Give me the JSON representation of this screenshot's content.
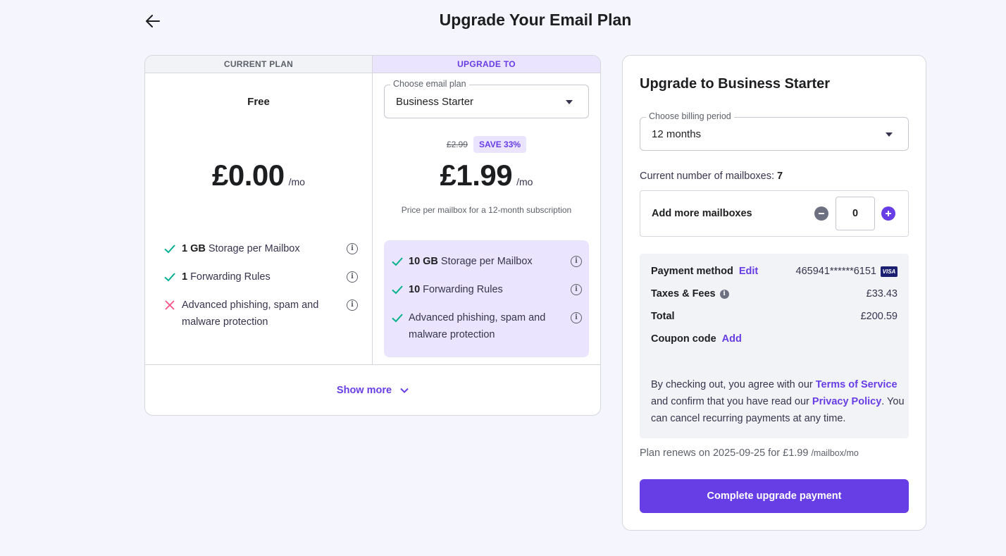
{
  "page": {
    "title": "Upgrade Your Email Plan"
  },
  "current_plan": {
    "header": "CURRENT PLAN",
    "name": "Free",
    "price": "£0.00",
    "per": "/mo",
    "features": [
      {
        "bold": "1 GB",
        "text": "Storage per Mailbox",
        "included": true
      },
      {
        "bold": "1",
        "text": "Forwarding Rules",
        "included": true
      },
      {
        "bold": "",
        "text": "Advanced phishing, spam and malware protection",
        "included": false
      }
    ]
  },
  "upgrade_plan": {
    "header": "UPGRADE TO",
    "select_label": "Choose email plan",
    "select_value": "Business Starter",
    "old_price": "£2.99",
    "save_badge": "SAVE 33%",
    "price": "£1.99",
    "per": "/mo",
    "price_note": "Price per mailbox for a 12-month subscription",
    "features": [
      {
        "bold": "10 GB",
        "text": "Storage per Mailbox",
        "included": true
      },
      {
        "bold": "10",
        "text": "Forwarding Rules",
        "included": true
      },
      {
        "bold": "",
        "text": "Advanced phishing, spam and malware protection",
        "included": true
      }
    ]
  },
  "show_more": "Show more",
  "checkout": {
    "title": "Upgrade to Business Starter",
    "billing_label": "Choose billing period",
    "billing_value": "12 months",
    "mailbox_count_label": "Current number of mailboxes:",
    "mailbox_count": "7",
    "add_mailboxes_label": "Add more mailboxes",
    "add_mailboxes_value": "0",
    "payment_method_label": "Payment method",
    "payment_edit": "Edit",
    "card_number": "465941******6151",
    "card_brand": "VISA",
    "taxes_label": "Taxes & Fees",
    "taxes_value": "£33.43",
    "total_label": "Total",
    "total_value": "£200.59",
    "coupon_label": "Coupon code",
    "coupon_add": "Add",
    "legal_1": "By checking out, you agree with our",
    "terms_link": "Terms of Service",
    "legal_2": "and confirm that you have read our",
    "privacy_link": "Privacy Policy",
    "legal_3": ". You can cancel recurring payments at any time.",
    "renews_text": "Plan renews on 2025-09-25 for £1.99",
    "renews_unit": "/mailbox/mo",
    "pay_button": "Complete upgrade payment"
  },
  "colors": {
    "accent": "#673de6",
    "accent_light": "#ebe4ff",
    "check": "#00b090",
    "cross": "#fc5185",
    "background": "#f4f5fd"
  }
}
